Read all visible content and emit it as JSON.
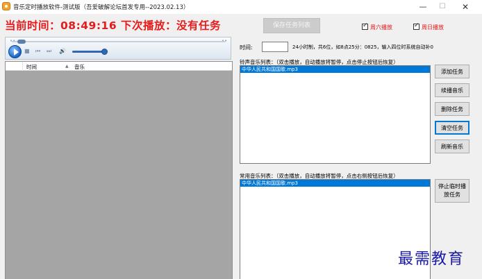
{
  "window": {
    "title": "音乐定时播放软件-测试版（吾爱破解论坛首发专用--2023.02.13）",
    "minimize_glyph": "—",
    "maximize_glyph": "☐",
    "close_glyph": "✕",
    "icon": "app-music-icon"
  },
  "clock": {
    "text": "当前时间：08:49:16  下次播放：没有任务"
  },
  "toolbar": {
    "save_task_list": "保存任务列表",
    "saturday_label": "周六播放",
    "sunday_label": "周日播放"
  },
  "player": {
    "play_icon": "play-icon",
    "stop_glyph": "■",
    "prev_glyph": "⏮",
    "next_glyph": "⏭",
    "volume_glyph": "🔊",
    "seek_dots_left": "••",
    "seek_dots_right": "••"
  },
  "task_list": {
    "columns": [
      "",
      "时间",
      "▲",
      "音乐"
    ]
  },
  "time_entry": {
    "label": "时间:",
    "value": "",
    "hint": "24小时制，共6位，如8点25分：0825，输入四位时系统自动补0"
  },
  "ring_list": {
    "label": "铃声音乐列表：（双击播放，自动播放将暂停，点击停止按钮后恢复）",
    "items": [
      "中华人民共和国国歌.mp3"
    ]
  },
  "common_list": {
    "label": "常用音乐列表：（双击播放，自动播放将暂停，点击右侧按钮后恢复）",
    "items": [
      "中华人民共和国国歌.mp3"
    ]
  },
  "buttons": {
    "add_task": "添加任务",
    "continue_music": "续播音乐",
    "delete_task": "删除任务",
    "clear_task": "清空任务",
    "refresh_music": "刷新音乐",
    "stop_temp_line1": "停止临时播",
    "stop_temp_line2": "放任务"
  },
  "watermark": "最需教育"
}
